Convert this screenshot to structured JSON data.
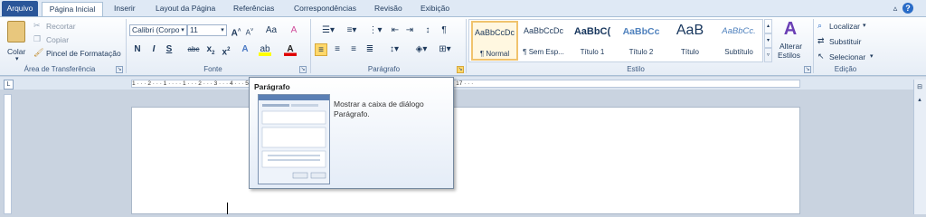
{
  "tabs": {
    "file": "Arquivo",
    "items": [
      "Página Inicial",
      "Inserir",
      "Layout da Página",
      "Referências",
      "Correspondências",
      "Revisão",
      "Exibição"
    ]
  },
  "clipboard": {
    "paste": "Colar",
    "cut": "Recortar",
    "copy": "Copiar",
    "painter": "Pincel de Formatação",
    "group": "Área de Transferência"
  },
  "font": {
    "name": "Calibri (Corpo",
    "size": "11",
    "group": "Fonte"
  },
  "paragraph": {
    "group": "Parágrafo"
  },
  "styles": {
    "group": "Estilo",
    "preview": "AaBbCcDc",
    "items": [
      {
        "preview": "AaBbCcDc",
        "name": "¶ Normal"
      },
      {
        "preview": "AaBbCcDc",
        "name": "¶ Sem Esp..."
      },
      {
        "preview": "AaBbC(",
        "name": "Título 1"
      },
      {
        "preview": "AaBbCc",
        "name": "Título 2"
      },
      {
        "preview": "AaB",
        "name": "Título"
      },
      {
        "preview": "AaBbCc.",
        "name": "Subtítulo"
      }
    ],
    "change_label": "Alterar",
    "change_label2": "Estilos"
  },
  "editing": {
    "find": "Localizar",
    "replace": "Substituir",
    "select": "Selecionar",
    "group": "Edição"
  },
  "ruler": {
    "marks": "1 · · · 2 · · · 1 · · · · 1 · · · 2 · · · 3 · · · 4 · · · 5 · · · 6 · · · 7 · · · 8 · · · 9 · · · 10 · · · 11 · · · 12 · · · 13 · · · 14 · · · 15 · · · 16 · · · 17 · · ·"
  },
  "tooltip": {
    "title": "Parágrafo",
    "description": "Mostrar a caixa de diálogo Parágrafo."
  },
  "colors": {
    "file_tab": "#2a5699",
    "ribbon": "#fdfeff",
    "selected_style": "#f0c36d"
  }
}
